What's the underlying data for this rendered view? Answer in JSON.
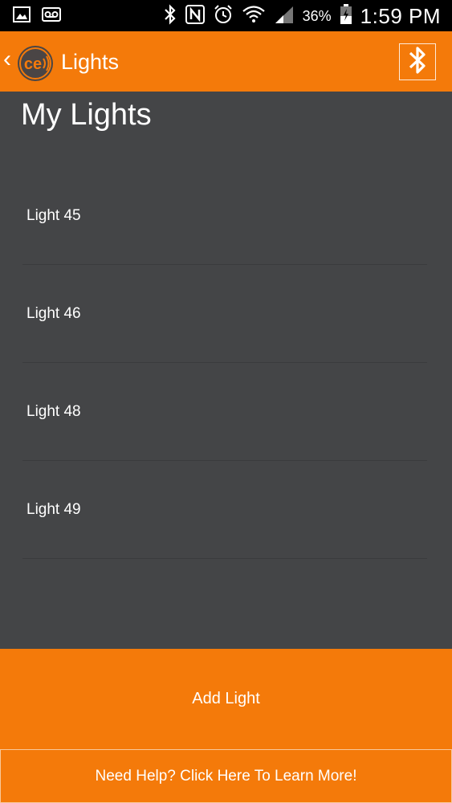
{
  "status_bar": {
    "battery_percent": "36%",
    "time": "1:59 PM",
    "icons": [
      "gallery-icon",
      "voicemail-icon",
      "bluetooth-icon",
      "nfc-icon",
      "alarm-icon",
      "wifi-icon",
      "signal-icon",
      "battery-icon"
    ]
  },
  "app_bar": {
    "title": "Lights",
    "logo_text": "ce",
    "icons": [
      "back-chevron-icon",
      "app-logo-icon",
      "bluetooth-icon"
    ]
  },
  "main": {
    "page_title": "My Lights",
    "lights": [
      {
        "label": "Light 45"
      },
      {
        "label": "Light 46"
      },
      {
        "label": "Light 48"
      },
      {
        "label": "Light 49"
      }
    ]
  },
  "actions": {
    "add_light_label": "Add Light",
    "help_label": "Need Help? Click Here To Learn More!"
  },
  "colors": {
    "accent": "#f47a0a",
    "background": "#444547",
    "status_bar": "#000000"
  }
}
